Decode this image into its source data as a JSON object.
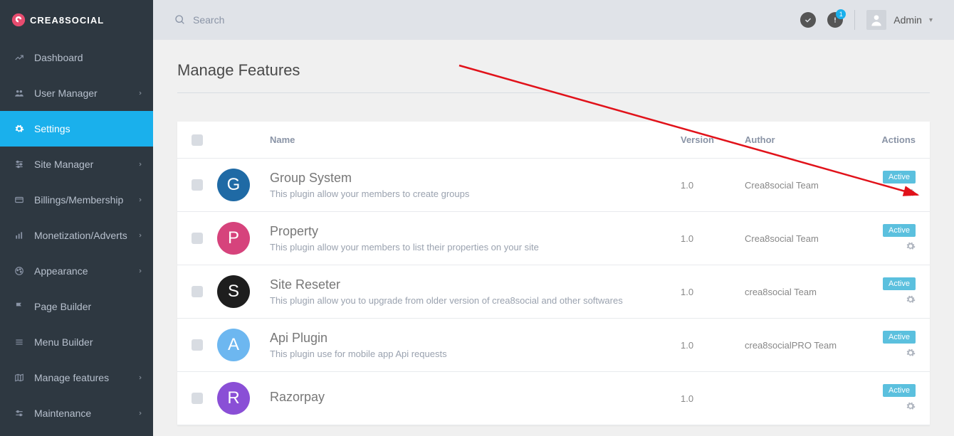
{
  "brand": "CREA8SOCIAL",
  "search": {
    "placeholder": "Search"
  },
  "topbar": {
    "notif_count": "1",
    "username": "Admin"
  },
  "nav": [
    {
      "label": "Dashboard",
      "chevron": false,
      "active": false,
      "icon": "dashboard"
    },
    {
      "label": "User Manager",
      "chevron": true,
      "active": false,
      "icon": "users"
    },
    {
      "label": "Settings",
      "chevron": false,
      "active": true,
      "icon": "gear"
    },
    {
      "label": "Site Manager",
      "chevron": true,
      "active": false,
      "icon": "sliders"
    },
    {
      "label": "Billings/Membership",
      "chevron": true,
      "active": false,
      "icon": "card"
    },
    {
      "label": "Monetization/Adverts",
      "chevron": true,
      "active": false,
      "icon": "chart"
    },
    {
      "label": "Appearance",
      "chevron": true,
      "active": false,
      "icon": "palette"
    },
    {
      "label": "Page Builder",
      "chevron": false,
      "active": false,
      "icon": "flag"
    },
    {
      "label": "Menu Builder",
      "chevron": false,
      "active": false,
      "icon": "menu"
    },
    {
      "label": "Manage features",
      "chevron": true,
      "active": false,
      "icon": "map"
    },
    {
      "label": "Maintenance",
      "chevron": true,
      "active": false,
      "icon": "wrench"
    }
  ],
  "page": {
    "title": "Manage Features"
  },
  "columns": {
    "name": "Name",
    "version": "Version",
    "author": "Author",
    "actions": "Actions"
  },
  "status_label": "Active",
  "plugins": [
    {
      "letter": "G",
      "color": "#1f6aa5",
      "name": "Group System",
      "desc": "This plugin allow your members to create groups",
      "version": "1.0",
      "author": "Crea8social Team"
    },
    {
      "letter": "P",
      "color": "#d6437c",
      "name": "Property",
      "desc": "This plugin allow your members to list their properties on your site",
      "version": "1.0",
      "author": "Crea8social Team"
    },
    {
      "letter": "S",
      "color": "#1e1e1e",
      "name": "Site Reseter",
      "desc": "This plugin allow you to upgrade from older version of crea8social and other softwares",
      "version": "1.0",
      "author": "crea8social Team"
    },
    {
      "letter": "A",
      "color": "#6db7f0",
      "name": "Api Plugin",
      "desc": "This plugin use for mobile app Api requests",
      "version": "1.0",
      "author": "crea8socialPRO Team"
    },
    {
      "letter": "R",
      "color": "#8a4fd6",
      "name": "Razorpay",
      "desc": "",
      "version": "1.0",
      "author": ""
    }
  ]
}
